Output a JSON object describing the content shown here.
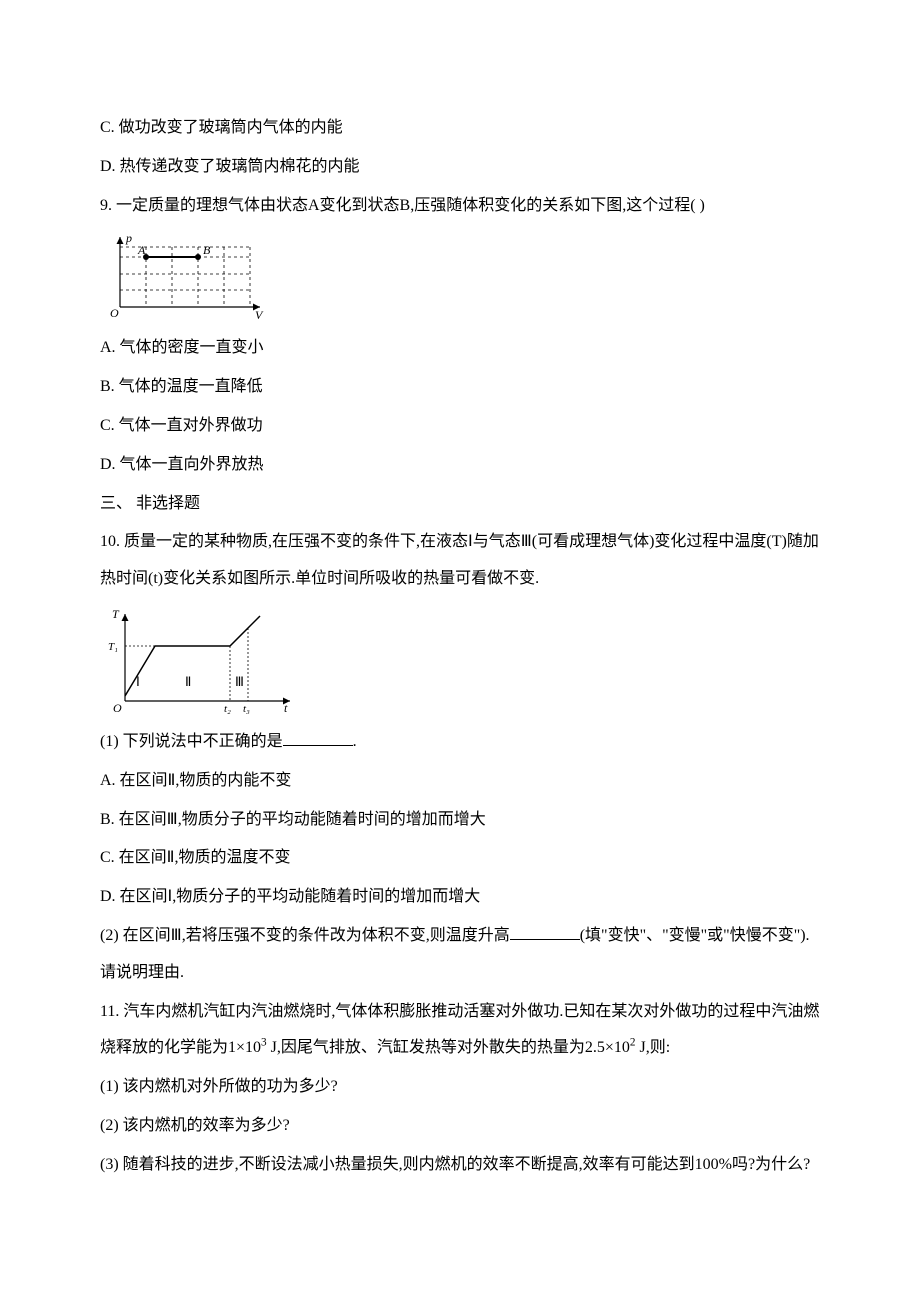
{
  "lines": {
    "c": "C.  做功改变了玻璃筒内气体的内能",
    "d": "D.  热传递改变了玻璃筒内棉花的内能",
    "q9": "9.  一定质量的理想气体由状态A变化到状态B,压强随体积变化的关系如下图,这个过程(      )",
    "q9a": "A.  气体的密度一直变小",
    "q9b": "B.  气体的温度一直降低",
    "q9c": "C.  气体一直对外界做功",
    "q9d": "D.  气体一直向外界放热",
    "section3": "三、 非选择题",
    "q10": "10.  质量一定的某种物质,在压强不变的条件下,在液态Ⅰ与气态Ⅲ(可看成理想气体)变化过程中温度(T)随加热时间(t)变化关系如图所示.单位时间所吸收的热量可看做不变.",
    "q10_1a": "(1) 下列说法中不正确的是",
    "q10_1b": ".",
    "q10a": "A.  在区间Ⅱ,物质的内能不变",
    "q10b": "B.  在区间Ⅲ,物质分子的平均动能随着时间的增加而增大",
    "q10c": "C.  在区间Ⅱ,物质的温度不变",
    "q10d": "D.  在区间Ⅰ,物质分子的平均动能随着时间的增加而增大",
    "q10_2a": "(2) 在区间Ⅲ,若将压强不变的条件改为体积不变,则温度升高",
    "q10_2b": "(填\"变快\"、\"变慢\"或\"快慢不变\").请说明理由.",
    "q11a": "11.  汽车内燃机汽缸内汽油燃烧时,气体体积膨胀推动活塞对外做功.已知在某次对外做功的过程中汽油燃烧释放的化学能为1×10",
    "q11b": " J,因尾气排放、汽缸发热等对外散失的热量为2.5×10",
    "q11c": " J,则:",
    "q11_1": "(1) 该内燃机对外所做的功为多少?",
    "q11_2": "(2) 该内燃机的效率为多少?",
    "q11_3": "(3) 随着科技的进步,不断设法减小热量损失,则内燃机的效率不断提高,效率有可能达到100%吗?为什么?",
    "exp3": "3",
    "exp2": "2"
  },
  "fig1": {
    "p_label": "p",
    "v_label": "V",
    "o_label": "O",
    "a_label": "A",
    "b_label": "B"
  },
  "fig2": {
    "t_label": "T",
    "t1_label": "T₁",
    "o_label": "O",
    "x_label": "t",
    "t2_label": "t₂",
    "t3_label": "t₃",
    "r1": "Ⅰ",
    "r2": "Ⅱ",
    "r3": "Ⅲ"
  }
}
